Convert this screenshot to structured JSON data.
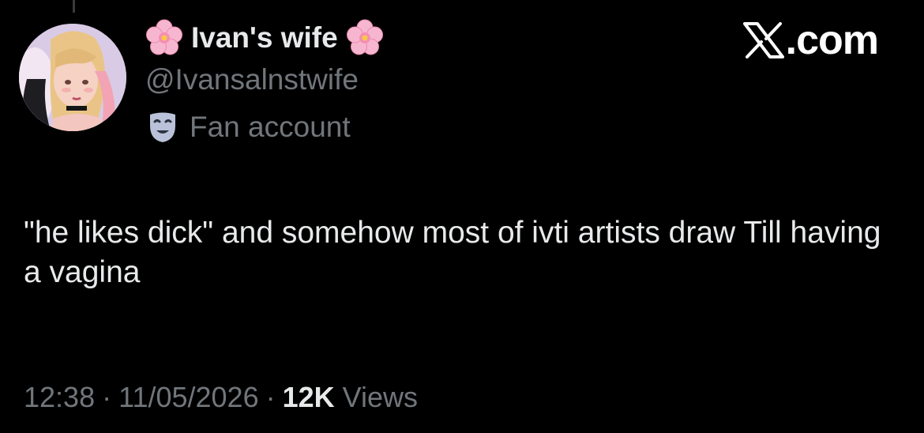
{
  "author": {
    "display_name": "Ivan's wife",
    "handle": "@Ivansalnstwife",
    "label": "Fan account",
    "name_emoji_icon": "cherry-blossom-icon",
    "label_icon": "performing-arts-mask-icon"
  },
  "brand": {
    "icon": "x-logo-icon",
    "text": ".com"
  },
  "tweet": {
    "text": "\"he likes dick\" and somehow most of ivti artists draw Till having a vagina"
  },
  "meta": {
    "time": "12:38",
    "separator": "·",
    "date": "11/05/2026",
    "views_count": "12K",
    "views_label": "Views"
  },
  "colors": {
    "background": "#000000",
    "primary_text": "#e7e9ea",
    "secondary_text": "#71767b",
    "blossom": "#f7b6cf"
  }
}
